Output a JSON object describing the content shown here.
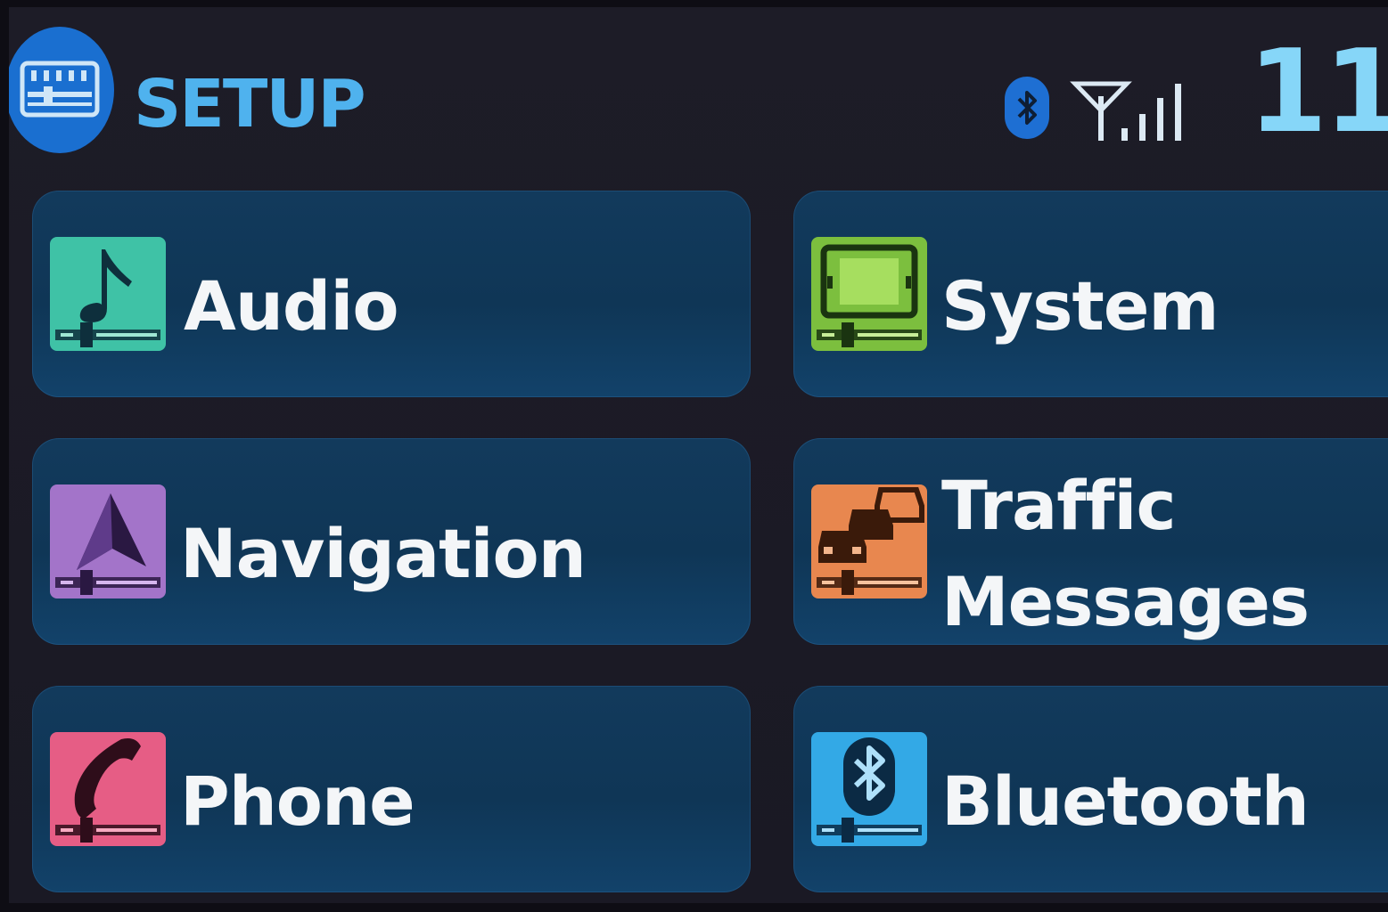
{
  "header": {
    "title": "SETUP",
    "badge_icon": "setup-menu-icon",
    "status": {
      "bluetooth_icon": "bluetooth-status-icon",
      "signal_icon": "signal-strength-icon"
    },
    "clock": "11"
  },
  "tiles": [
    {
      "id": "audio",
      "label": "Audio",
      "icon": "music-note-icon",
      "color": "#3fc2a6"
    },
    {
      "id": "system",
      "label": "System",
      "icon": "display-icon",
      "color": "#7cbf3e"
    },
    {
      "id": "navigation",
      "label": "Navigation",
      "icon": "navigation-arrow-icon",
      "color": "#a374c9"
    },
    {
      "id": "traffic",
      "label_line1": "Traffic",
      "label_line2": "Messages",
      "icon": "traffic-cars-icon",
      "color": "#e8874f"
    },
    {
      "id": "phone",
      "label": "Phone",
      "icon": "phone-handset-icon",
      "color": "#e65d85"
    },
    {
      "id": "bluetooth",
      "label": "Bluetooth",
      "icon": "bluetooth-icon",
      "color": "#33a9e6"
    }
  ],
  "colors": {
    "accent_blue": "#4fb2ee",
    "tile_bg": "#0f3656",
    "background": "#1b1a24"
  }
}
